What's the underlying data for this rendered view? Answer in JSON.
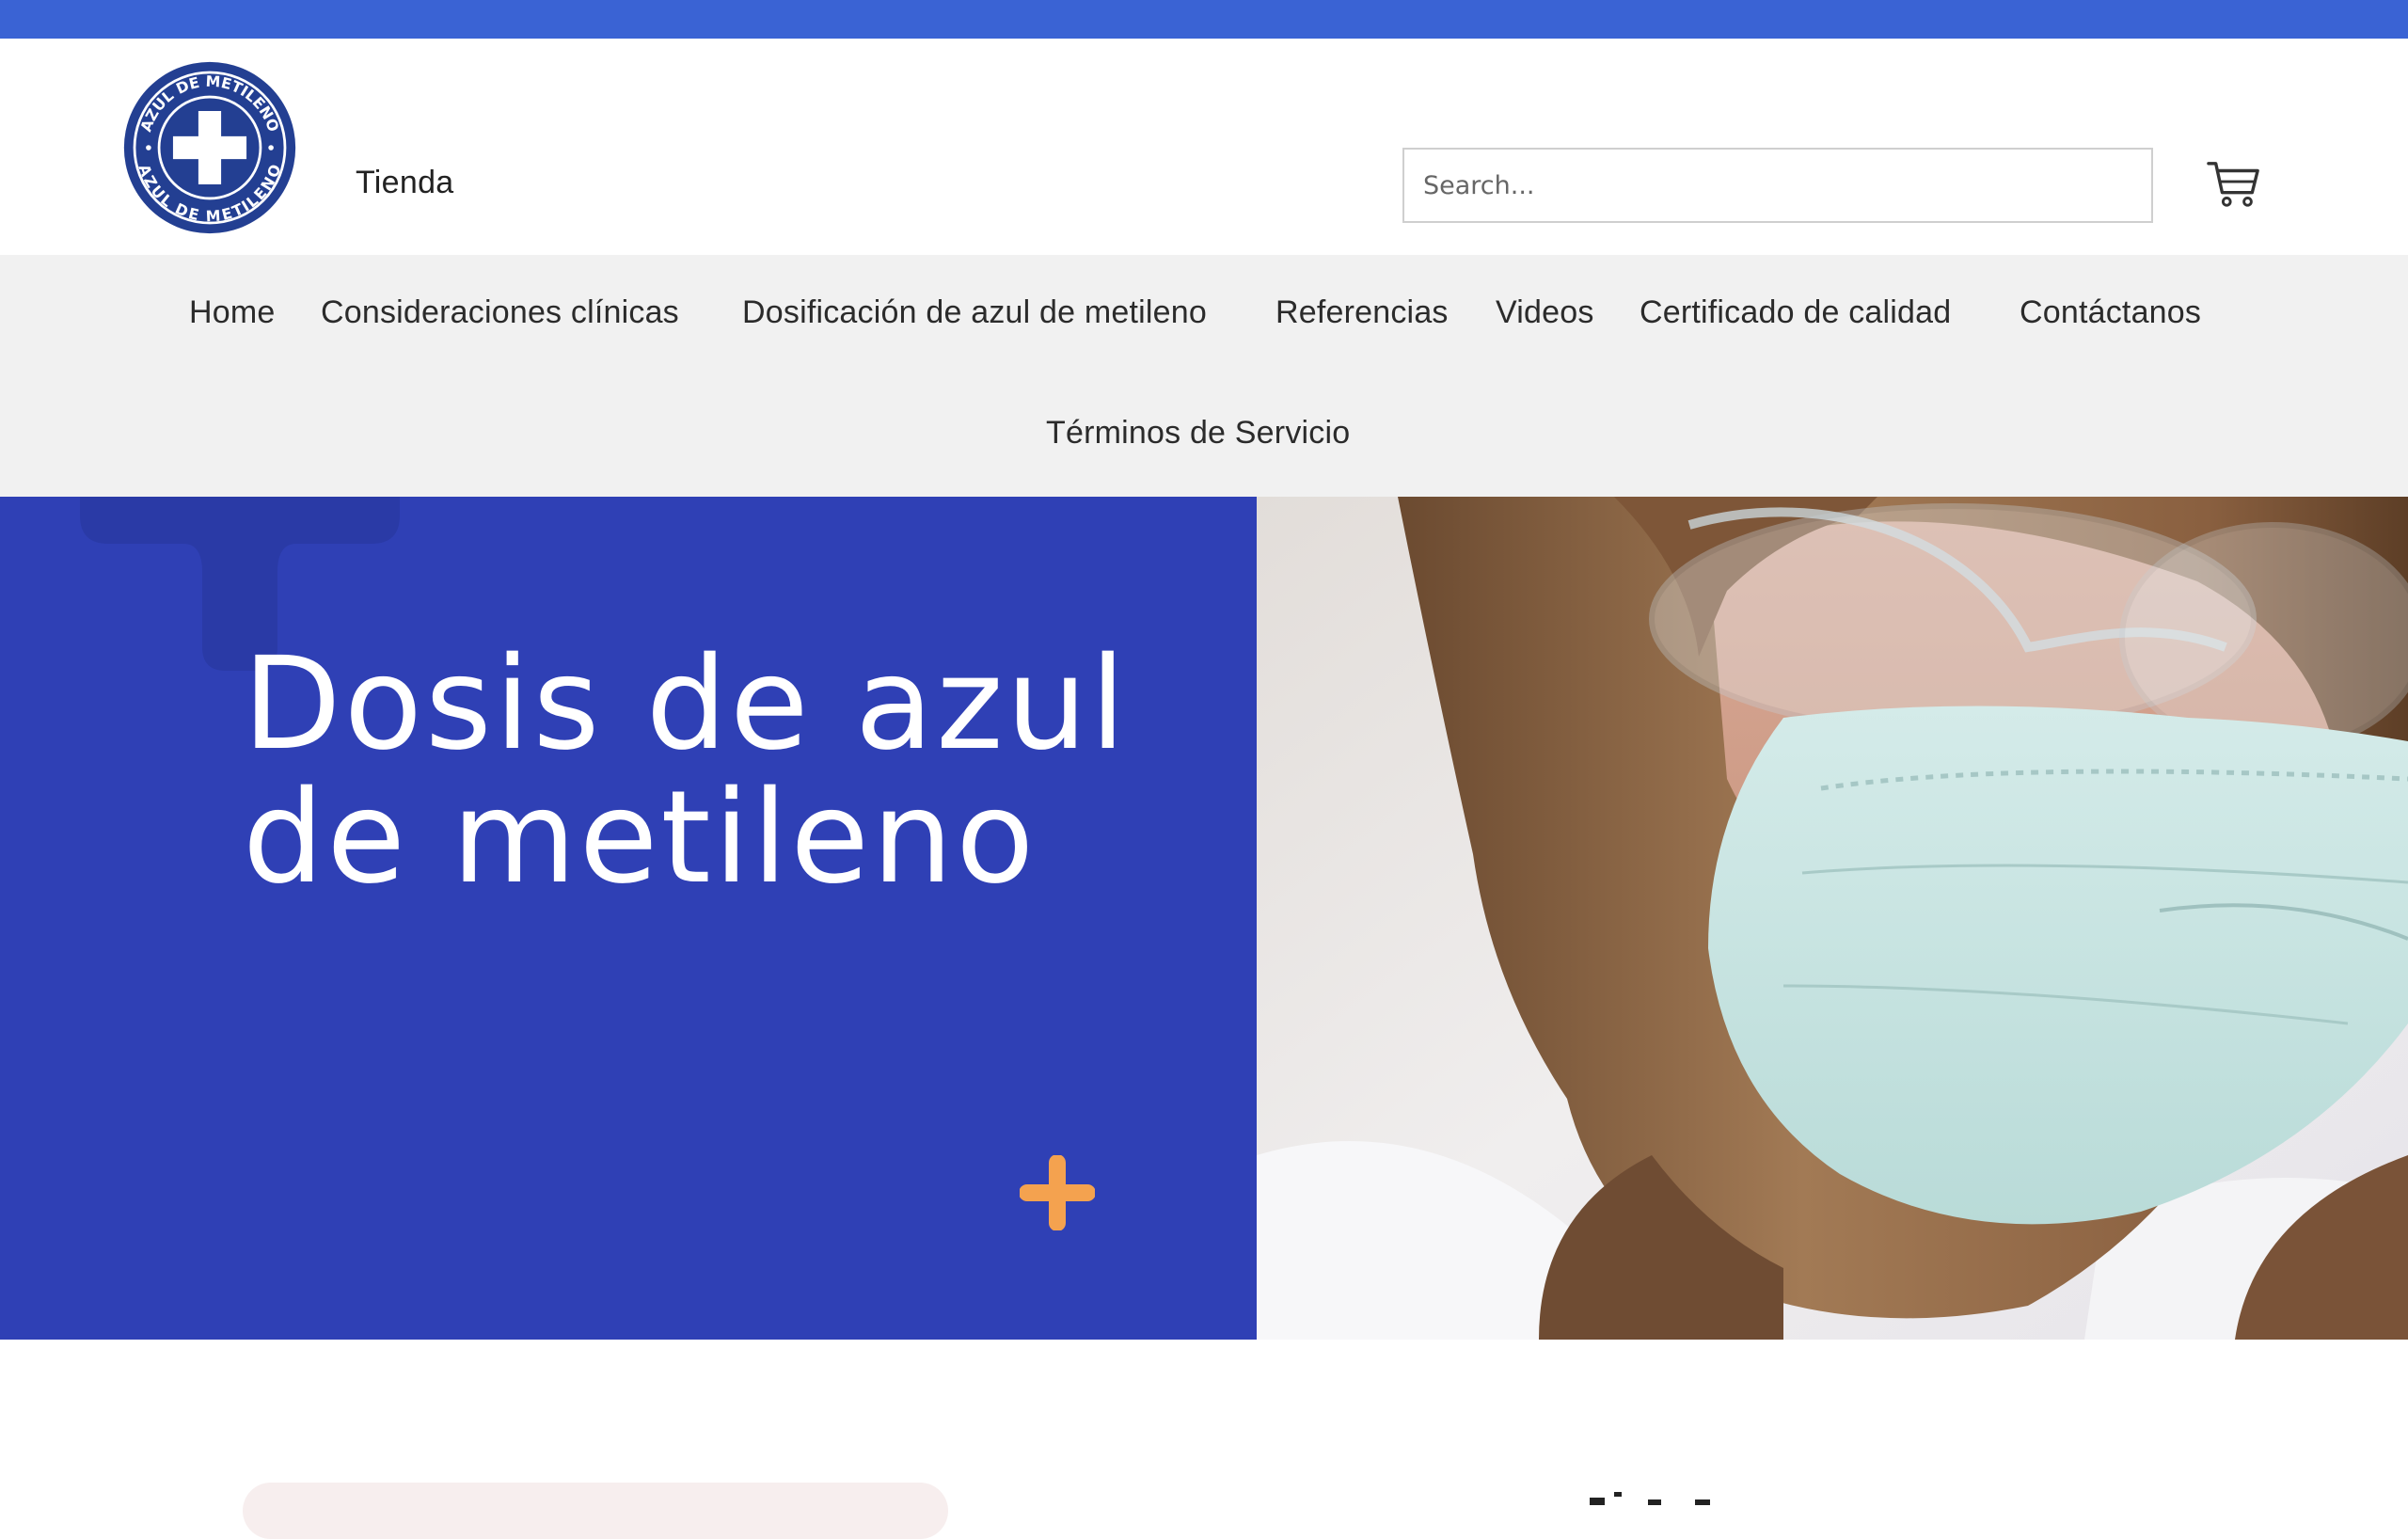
{
  "header": {
    "logo_text": "AZUL DE METILENO",
    "shop_label": "Tienda",
    "search": {
      "placeholder": "Search..."
    }
  },
  "nav": {
    "items": [
      "Home",
      "Consideraciones clínicas",
      "Dosificación de azul de metileno",
      "Referencias",
      "Videos",
      "Certificado de calidad",
      "Contáctanos",
      "Términos de Servicio"
    ]
  },
  "hero": {
    "title": "Dosis de azul de metileno"
  },
  "colors": {
    "top_strip": "#3a63d4",
    "logo_blue": "#233f92",
    "hero_blue": "#2f40b5",
    "accent_orange": "#f4a24f",
    "nav_bg": "#f1f1f1"
  },
  "icons": {
    "logo": "medical-cross-seal",
    "cart": "shopping-cart-icon",
    "accent": "plus-icon"
  }
}
